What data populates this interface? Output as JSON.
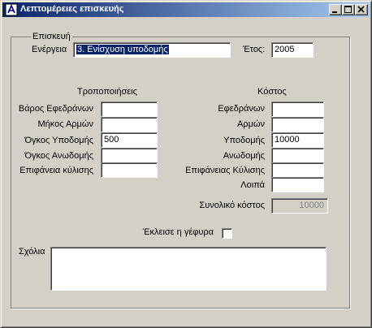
{
  "window": {
    "title": "Λεπτομέρειες επισκευής",
    "buttons": {
      "minimize": "minimize",
      "maximize": "maximize",
      "close": "close"
    }
  },
  "group": {
    "label": "Επισκευή"
  },
  "energeia": {
    "label": "Ενέργεια",
    "value": "3. Ενίσχυση υποδομής"
  },
  "year": {
    "label": "Έτος:",
    "value": "2005"
  },
  "modifications": {
    "heading": "Τροποποιήσεις",
    "rows": [
      {
        "label": "Βάρος Εφεδράνων",
        "value": ""
      },
      {
        "label": "Μήκος Αρμών",
        "value": ""
      },
      {
        "label": "Όγκος Υποδομής",
        "value": "500"
      },
      {
        "label": "Όγκος Ανωδομής",
        "value": ""
      },
      {
        "label": "Επιφάνεια κύλισης",
        "value": ""
      }
    ]
  },
  "cost": {
    "heading": "Κόστος",
    "rows": [
      {
        "label": "Εφεδράνων",
        "value": ""
      },
      {
        "label": "Αρμών",
        "value": ""
      },
      {
        "label": "Υποδομής",
        "value": "10000"
      },
      {
        "label": "Ανωδομής",
        "value": ""
      },
      {
        "label": "Επιφάνειας Κύλισης",
        "value": ""
      },
      {
        "label": "Λοιπά",
        "value": ""
      }
    ],
    "total_label": "Συνολικό κόστος",
    "total_value": "10000"
  },
  "bridge_closed": {
    "label": "Έκλεισε η γέφυρα",
    "checked": false
  },
  "comments": {
    "label": "Σχόλια",
    "value": ""
  }
}
